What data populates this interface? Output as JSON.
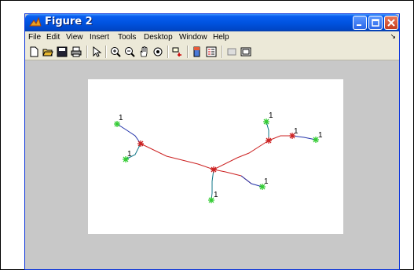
{
  "window": {
    "title": "Figure 2"
  },
  "menu": [
    "File",
    "Edit",
    "View",
    "Insert",
    "Tools",
    "Desktop",
    "Window",
    "Help"
  ],
  "toolbar": [
    "new",
    "open",
    "save",
    "print",
    "arrow",
    "zoom-in",
    "zoom-out",
    "pan",
    "rotate",
    "data-cursor",
    "colorbar",
    "legend",
    "hide-plot-tools",
    "show-plot-tools"
  ],
  "plot": {
    "node_label": "1",
    "colors": {
      "trunk": "#cc2222",
      "branch_a": "#2233aa",
      "branch_b": "#117788",
      "leaf": "#33cc33",
      "hub": "#cc2222"
    }
  }
}
